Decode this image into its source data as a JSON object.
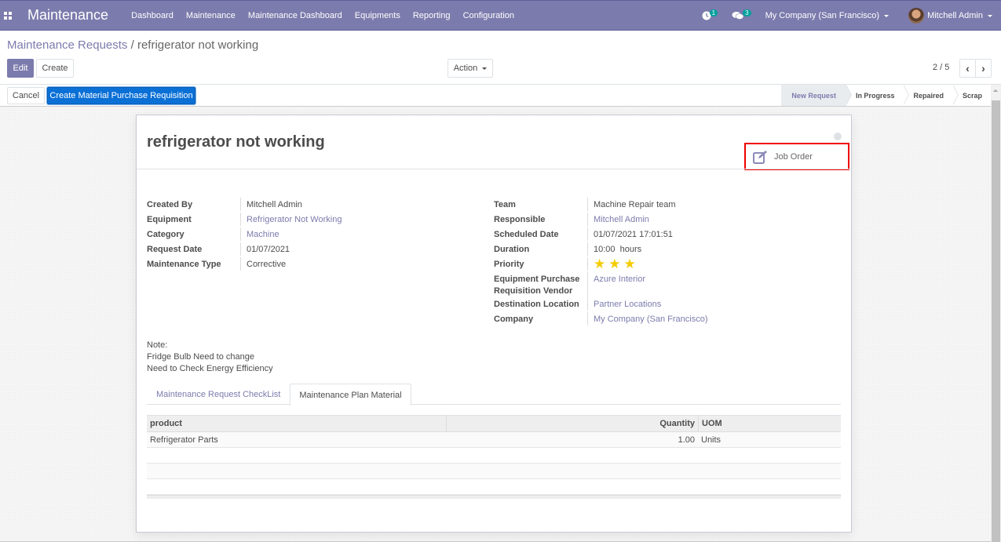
{
  "navbar": {
    "app_title": "Maintenance",
    "menu": [
      "Dashboard",
      "Maintenance",
      "Maintenance Dashboard",
      "Equipments",
      "Reporting",
      "Configuration"
    ],
    "activity_count": "1",
    "messages_count": "3",
    "company": "My Company (San Francisco)",
    "user": "Mitchell Admin",
    "brand_color": "#7c7bad"
  },
  "control_panel": {
    "breadcrumb_parent": "Maintenance Requests",
    "breadcrumb_sep": "/",
    "breadcrumb_current": "refrigerator not working",
    "edit_label": "Edit",
    "create_label": "Create",
    "action_label": "Action",
    "pager": "2 / 5",
    "prev_icon": "‹",
    "next_icon": "›"
  },
  "statusbar": {
    "cancel_label": "Cancel",
    "cmpr_label": "Create Material Purchase Requisition",
    "stages": [
      {
        "label": "New Request",
        "active": true
      },
      {
        "label": "In Progress",
        "active": false
      },
      {
        "label": "Repaired",
        "active": false
      },
      {
        "label": "Scrap",
        "active": false
      }
    ]
  },
  "form": {
    "title": "refrigerator not working",
    "job_order_label": "Job Order",
    "left_fields": [
      {
        "label": "Created By",
        "value": "Mitchell Admin",
        "link": false
      },
      {
        "label": "Equipment",
        "value": "Refrigerator Not Working",
        "link": true
      },
      {
        "label": "Category",
        "value": "Machine",
        "link": true
      },
      {
        "label": "Request Date",
        "value": "01/07/2021",
        "link": false
      },
      {
        "label": "Maintenance Type",
        "value": "Corrective",
        "link": false
      }
    ],
    "right_fields": [
      {
        "label": "Team",
        "value": "Machine Repair team",
        "link": false
      },
      {
        "label": "Responsible",
        "value": "Mitchell Admin",
        "link": true
      },
      {
        "label": "Scheduled Date",
        "value": "01/07/2021 17:01:51",
        "link": false
      },
      {
        "label": "Duration",
        "value": "10:00  hours",
        "link": false
      },
      {
        "label": "Priority",
        "value": "3 of 3 stars",
        "link": false
      },
      {
        "label": "Equipment Purchase Requisition Vendor",
        "value": "Azure Interior",
        "link": true
      },
      {
        "label": "Destination Location",
        "value": "Partner Locations",
        "link": true
      },
      {
        "label": "Company",
        "value": "My Company (San Francisco)",
        "link": true
      }
    ],
    "priority_stars": 3,
    "priority_max": 3,
    "note_lines": [
      "Note:",
      "Fridge Bulb Need to change",
      "Need to Check Energy Efficiency"
    ],
    "tabs": [
      {
        "label": "Maintenance Request CheckList",
        "active": false
      },
      {
        "label": "Maintenance Plan Material",
        "active": true
      }
    ],
    "table": {
      "headers": [
        "product",
        "Quantity",
        "UOM"
      ],
      "rows": [
        [
          "Refrigerator Parts",
          "1.00",
          "Units"
        ]
      ]
    }
  }
}
